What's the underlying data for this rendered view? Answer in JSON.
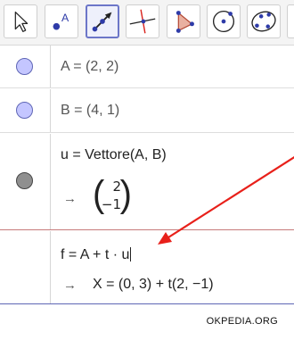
{
  "toolbar": {
    "tools": [
      {
        "name": "move-tool",
        "icon": "cursor-arrow-icon"
      },
      {
        "name": "point-tool",
        "icon": "point-icon",
        "label": "A"
      },
      {
        "name": "vector-tool",
        "icon": "vector-icon",
        "selected": true
      },
      {
        "name": "perpendicular-line-tool",
        "icon": "perpendicular-line-icon"
      },
      {
        "name": "polygon-tool",
        "icon": "polygon-icon"
      },
      {
        "name": "circle-center-point-tool",
        "icon": "circle-center-point-icon"
      },
      {
        "name": "conic-tool",
        "icon": "conic-five-points-icon"
      }
    ]
  },
  "algebra": {
    "rows": [
      {
        "id": "A",
        "text": "A = (2, 2)",
        "dot": "#c4c6ff"
      },
      {
        "id": "B",
        "text": "B = (4, 1)",
        "dot": "#c4c6ff"
      },
      {
        "id": "u",
        "text": "u = Vettore(A, B)",
        "output_arrow": "→",
        "vector": [
          "2",
          "−1"
        ],
        "dot": "#8f8f8f"
      },
      {
        "id": "f",
        "input": "f = A + t · u",
        "output_arrow": "→",
        "output": "X = (0, 3) + t(2, −1)"
      }
    ]
  },
  "annotation": {
    "arrow_color": "#e8201a"
  },
  "watermark": "OKPEDIA.ORG"
}
